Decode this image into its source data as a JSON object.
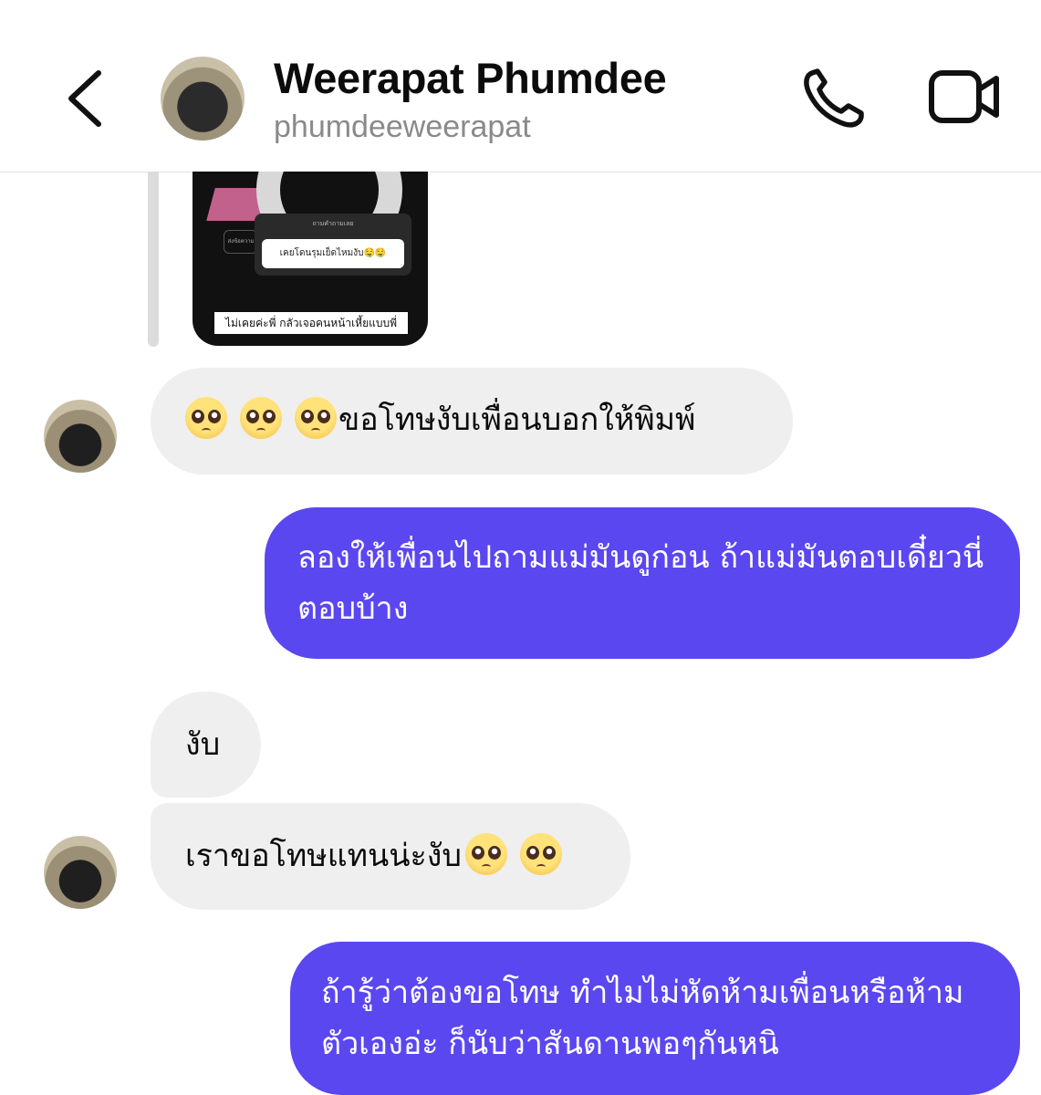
{
  "header": {
    "name": "Weerapat Phumdee",
    "username": "phumdeeweerapat"
  },
  "story": {
    "question_header": "ถามคำถามเลย",
    "question_text": "เคยโดนรุมเย็ดไหมงับ🤤🤤",
    "side_label": "ส่งข้อความ",
    "caption": "ไม่เคยค่ะพี่ กลัวเจอคนหน้าเหี้ยแบบพี่"
  },
  "messages": [
    {
      "from": "them",
      "text": "ขอโทษงับเพื่อนบอกให้พิมพ์",
      "emoji_prefix_count": 3
    },
    {
      "from": "me",
      "text": "ลองให้เพื่อนไปถามแม่มันดูก่อน ถ้าแม่มันตอบเดี๋ยวนี่ตอบบ้าง"
    },
    {
      "from": "them",
      "text": "งับ"
    },
    {
      "from": "them",
      "text": "เราขอโทษแทนน่ะงับ",
      "emoji_suffix_count": 2
    },
    {
      "from": "me",
      "text": "ถ้ารู้ว่าต้องขอโทษ ทำไมไม่หัดห้ามเพื่อนหรือห้ามตัวเองอ่ะ ก็นับว่าสันดานพอๆกันหนิ"
    }
  ],
  "colors": {
    "outgoing_bubble": "#5b47f0",
    "incoming_bubble": "#efefef",
    "username_gray": "#8a8a8a"
  },
  "icons": [
    "back-chevron-icon",
    "phone-icon",
    "video-camera-icon",
    "pleading-face-emoji"
  ]
}
